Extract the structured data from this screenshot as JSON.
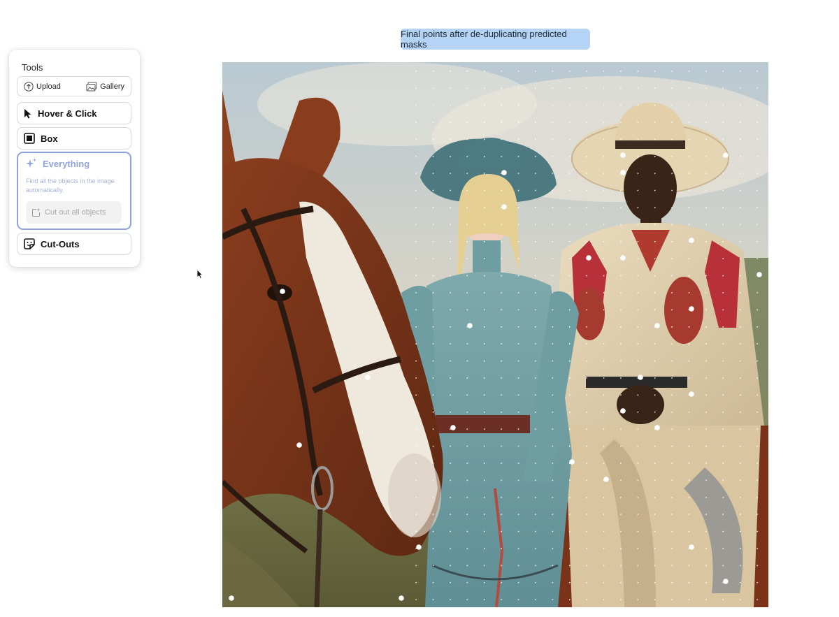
{
  "caption": "Final points after de-duplicating predicted masks",
  "tools": {
    "title": "Tools",
    "upload_label": "Upload",
    "gallery_label": "Gallery",
    "hover_click_label": "Hover & Click",
    "box_label": "Box",
    "everything": {
      "label": "Everything",
      "description": "Find all the objects in the image automatically.",
      "cutout_button": "Cut out all objects"
    },
    "cutouts_label": "Cut-Outs"
  },
  "colors": {
    "accent": "#8fa3de",
    "caption_bg": "#b5d4f5"
  },
  "icons": {
    "upload": "upload-icon",
    "gallery": "gallery-icon",
    "hover_click": "cursor-arrow-icon",
    "box": "box-icon",
    "everything": "sparkles-icon",
    "cutout_all": "cutout-icon",
    "cutouts": "sticker-icon"
  },
  "image": {
    "description_icon": "photo-canvas"
  }
}
